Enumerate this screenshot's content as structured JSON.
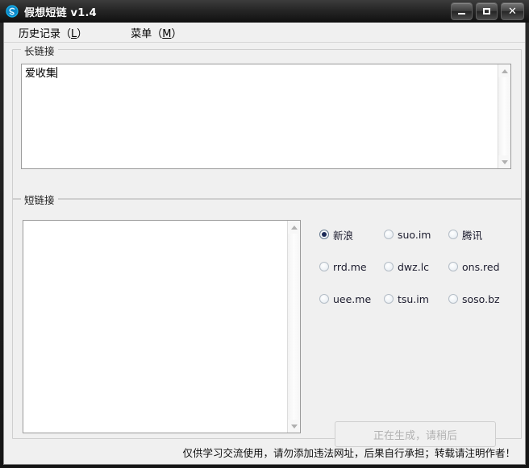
{
  "window": {
    "title": "假想短链 v1.4",
    "icon": "link-circle-icon",
    "controls": {
      "minimize_label": "–",
      "maximize_label": "□",
      "close_label": "✕"
    }
  },
  "menubar": {
    "items": [
      {
        "label": "历史记录（L）",
        "text": "历史记录（",
        "accel": "L",
        "tail": "）"
      },
      {
        "label": "菜单（M）",
        "text": "菜单（",
        "accel": "M",
        "tail": "）"
      }
    ]
  },
  "long_link": {
    "group_title": "长链接",
    "value": "爱收集",
    "placeholder": ""
  },
  "short_link": {
    "group_title": "短链接",
    "value": "",
    "placeholder": ""
  },
  "providers": {
    "selected": "新浪",
    "options": [
      {
        "label": "新浪",
        "checked": true
      },
      {
        "label": "suo.im",
        "checked": false
      },
      {
        "label": "腾讯",
        "checked": false
      },
      {
        "label": "rrd.me",
        "checked": false
      },
      {
        "label": "dwz.lc",
        "checked": false
      },
      {
        "label": "ons.red",
        "checked": false
      },
      {
        "label": "uee.me",
        "checked": false
      },
      {
        "label": "tsu.im",
        "checked": false
      },
      {
        "label": "soso.bz",
        "checked": false
      }
    ]
  },
  "generate_button": {
    "label": "正在生成，请稍后",
    "enabled": false
  },
  "footer": {
    "text": "仅供学习交流使用，请勿添加违法网址，后果自行承担；转载请注明作者！"
  },
  "colors": {
    "titlebar_text": "#ffffff",
    "client_background": "#f0f0f0",
    "textbox_background": "#ffffff",
    "radio_selected_dot": "#1b2a57",
    "button_disabled_text": "#b2b2b2"
  }
}
